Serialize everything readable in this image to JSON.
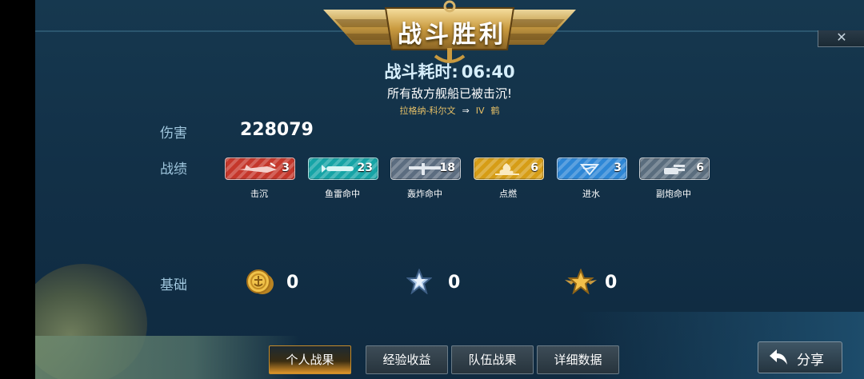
{
  "banner": {
    "title": "战斗胜利"
  },
  "close_label": "✕",
  "battle": {
    "duration_label": "战斗耗时:",
    "duration_value": "06:40",
    "subtitle": "所有敌方舰船已被击沉!",
    "ship_from": "拉格纳-科尔文",
    "arrow": "⇒",
    "tier": "IV",
    "ship_name": "鹤"
  },
  "damage": {
    "label": "伤害",
    "value": "228079"
  },
  "records": {
    "label": "战绩",
    "items": [
      {
        "name": "击沉",
        "count": "3",
        "icon": "sunk-ship-icon",
        "color": "#c5372b"
      },
      {
        "name": "鱼雷命中",
        "count": "23",
        "icon": "torpedo-icon",
        "color": "#16a4a6"
      },
      {
        "name": "轰炸命中",
        "count": "18",
        "icon": "bomber-icon",
        "color": "#5c6d80"
      },
      {
        "name": "点燃",
        "count": "6",
        "icon": "fire-icon",
        "color": "#d69d16"
      },
      {
        "name": "进水",
        "count": "3",
        "icon": "flooding-icon",
        "color": "#2e87d6"
      },
      {
        "name": "副炮命中",
        "count": "6",
        "icon": "secondary-gun-icon",
        "color": "#5a6d7e"
      }
    ]
  },
  "basic": {
    "label": "基础",
    "items": [
      {
        "icon": "gold-coin-icon",
        "value": "0"
      },
      {
        "icon": "silver-star-icon",
        "value": "0"
      },
      {
        "icon": "gold-star-icon",
        "value": "0"
      }
    ]
  },
  "tabs": [
    {
      "label": "个人战果",
      "active": true
    },
    {
      "label": "经验收益",
      "active": false
    },
    {
      "label": "队伍战果",
      "active": false
    },
    {
      "label": "详细数据",
      "active": false
    }
  ],
  "share": {
    "label": "分享",
    "icon": "share-back-arrow-icon"
  }
}
